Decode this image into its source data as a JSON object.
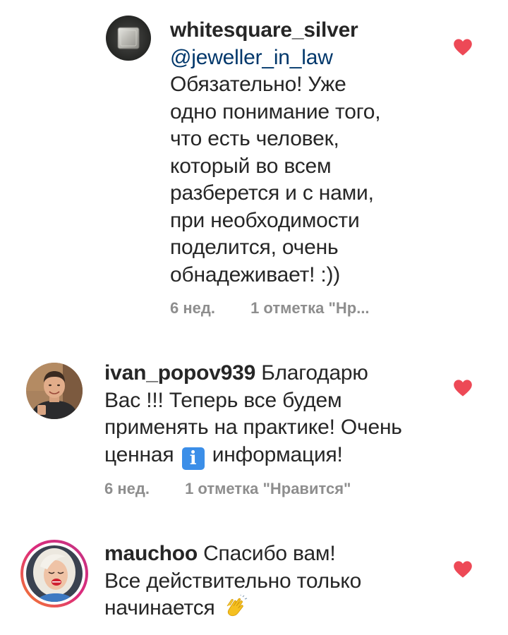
{
  "comments": [
    {
      "username": "whitesquare_silver",
      "mention": "@jeweller_in_law",
      "text_lines": [
        "Обязательно! Уже",
        "одно понимание того,",
        "что есть человек,",
        "который во всем",
        "разберется и с нами,",
        "при необходимости",
        "поделится, очень",
        "обнадеживает! :))"
      ],
      "time": "6 нед.",
      "likes": "1 отметка \"Нр...",
      "liked": true
    },
    {
      "username": "ivan_popov939",
      "text_first": "Благодарю",
      "text_lines": [
        "Вас !!! Теперь все будем",
        "применять на практике! Очень"
      ],
      "text_last_before": "ценная",
      "emoji_info": "i",
      "emoji_info_name": "information-emoji",
      "text_last_after": "информация!",
      "time": "6 нед.",
      "likes": "1 отметка \"Нравится\"",
      "liked": true
    },
    {
      "username": "mauchoo",
      "text_first": "Спасибо вам!",
      "text_lines": [
        "Все действительно только"
      ],
      "text_last": "начинается",
      "emoji_clap_name": "clapping-hands-emoji",
      "liked": true
    }
  ],
  "colors": {
    "heart": "#ed4956",
    "meta": "#8e8e8e",
    "mention": "#00376b",
    "text": "#262626",
    "story_ring_start": "#f58529",
    "story_ring_end": "#dd2a7b"
  },
  "icons": {
    "like": "heart-icon"
  }
}
